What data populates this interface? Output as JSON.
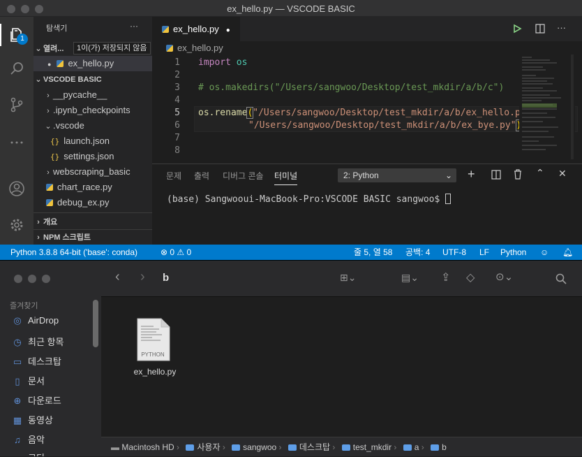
{
  "vscode": {
    "title": "ex_hello.py — VSCODE BASIC",
    "badge": "1",
    "explorer": {
      "header": "탐색기",
      "more": "···",
      "open_editors": "열려...",
      "unsaved_tooltip": "1이(가) 저장되지 않음",
      "open_file": "ex_hello.py",
      "workspace": "VSCODE BASIC",
      "items": [
        "__pycache__",
        ".ipynb_checkpoints",
        ".vscode",
        "launch.json",
        "settings.json",
        "webscraping_basic",
        "chart_race.py",
        "debug_ex.py"
      ],
      "outline": "개요",
      "npm": "NPM 스크립트"
    },
    "tab": {
      "label": "ex_hello.py",
      "dirty": "●"
    },
    "breadcrumb": "ex_hello.py",
    "line_numbers": [
      "1",
      "2",
      "3",
      "4",
      "5",
      "6",
      "7",
      "8"
    ],
    "code": {
      "l1_kw": "import",
      "l1_mod": " os",
      "l3": "# os.makedirs(\"/Users/sangwoo/Desktop/test_mkdir/a/b/c\")",
      "l5_fn": "os.rename",
      "l5_str": "\"/Users/sangwoo/Desktop/test_mkdir/a/b/ex_hello.py\"",
      "l5_end": ",",
      "l6_str": "\"/Users/sangwoo/Desktop/test_mkdir/a/b/ex_bye.py\"",
      "l6_end": ")"
    },
    "panel": {
      "tabs": [
        "문제",
        "출력",
        "디버그 콘솔",
        "터미널"
      ],
      "terminal_select": "2: Python",
      "prompt": "(base) Sangwooui-MacBook-Pro:VSCODE BASIC sangwoo$ "
    },
    "status": {
      "interpreter": "Python 3.8.8 64-bit ('base': conda)",
      "problems": "⊗ 0 ⚠ 0",
      "position": "줄 5, 열 58",
      "spaces": "공백: 4",
      "encoding": "UTF-8",
      "eol": "LF",
      "language": "Python"
    },
    "accent": "#007acc"
  },
  "finder": {
    "favorites_header": "즐겨찾기",
    "sidebar": [
      "AirDrop",
      "최근 항목",
      "데스크탑",
      "문서",
      "다운로드",
      "동영상",
      "음악",
      "코딩"
    ],
    "current_folder": "b",
    "file": {
      "name": "ex_hello.py",
      "kind": "PYTHON"
    },
    "path": [
      "Macintosh HD",
      "사용자",
      "sangwoo",
      "데스크탑",
      "test_mkdir",
      "a",
      "b"
    ]
  }
}
